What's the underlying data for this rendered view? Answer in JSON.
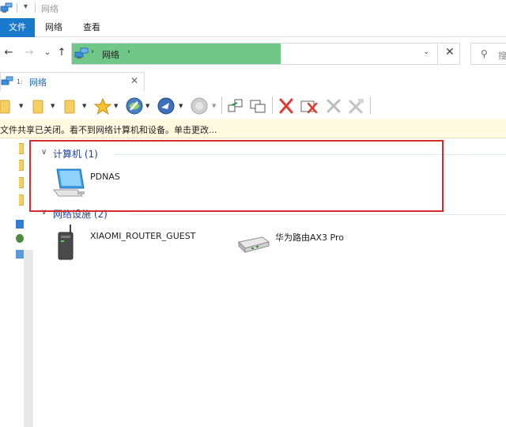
{
  "window": {
    "title": "网络",
    "quick_access_dropdown": "▾"
  },
  "ribbon": {
    "tabs": [
      "文件",
      "网络",
      "查看"
    ]
  },
  "navigation": {
    "back": "←",
    "forward": "→",
    "recent": "⌄",
    "up": "↑"
  },
  "address_bar": {
    "crumb_separator": "›",
    "path": [
      "网络"
    ],
    "dropdown": "⌄",
    "clear": "✕"
  },
  "search": {
    "placeholder": "搜"
  },
  "document_tab": {
    "number": "1:",
    "label": "网络",
    "close": "✕"
  },
  "toolbar": {
    "icons": [
      "folder-icon",
      "folder-icon",
      "folder-icon",
      "favorites-star-icon",
      "globe-back-icon",
      "globe-forward-icon",
      "globe-disabled-icon",
      "map-drive-icon",
      "copy-window-icon",
      "delete-icon",
      "delete-window-icon",
      "cut-disabled-icon",
      "clear-disabled-icon"
    ]
  },
  "info_bar": {
    "message": "文件共享已关闭。看不到网络计算机和设备。单击更改..."
  },
  "groups": [
    {
      "chevron": "∨",
      "title": "计算机 (1)",
      "items": [
        {
          "name": "PDNAS",
          "icon": "computer-icon"
        }
      ]
    },
    {
      "chevron": "∨",
      "title": "网络设施 (2)",
      "items": [
        {
          "name": "XIAOMI_ROUTER_GUEST",
          "icon": "router-tower-icon"
        },
        {
          "name": "华为路由AX3 Pro",
          "icon": "router-flat-icon"
        }
      ]
    }
  ],
  "colors": {
    "file_tab": "#1979ca",
    "address_highlight": "#6fc788",
    "info_bar": "#fffbe1",
    "group_title": "#1e3fa0",
    "annotation_box": "#d42c2c"
  }
}
